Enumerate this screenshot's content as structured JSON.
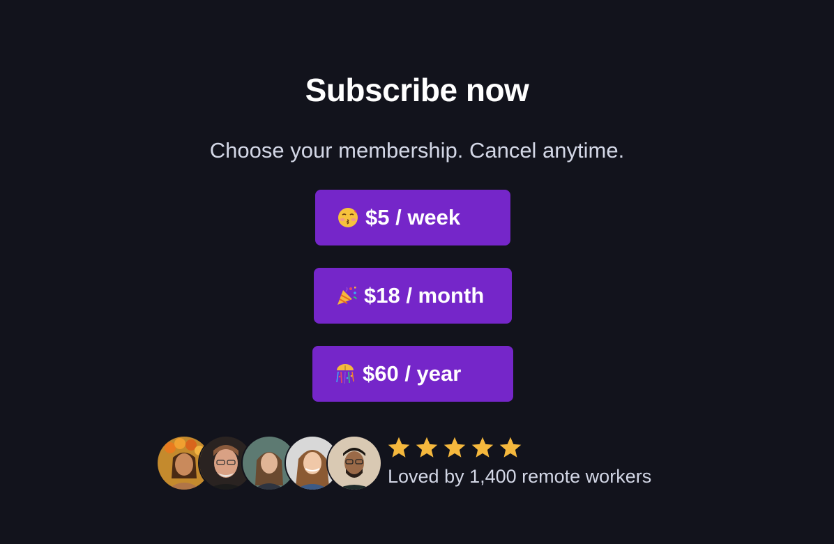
{
  "header": {
    "title": "Subscribe now",
    "subtitle": "Choose your membership. Cancel anytime."
  },
  "plans": [
    {
      "label": "$5 / week",
      "icon": "kissing-face-emoji-icon"
    },
    {
      "label": "$18 / month",
      "icon": "party-popper-emoji-icon"
    },
    {
      "label": "$60 / year",
      "icon": "confetti-ball-emoji-icon"
    }
  ],
  "social_proof": {
    "avatars": [
      "woman-flower-crown-avatar",
      "older-man-glasses-avatar",
      "woman-long-hair-avatar",
      "woman-smiling-avatar",
      "man-glasses-beard-avatar"
    ],
    "rating": 5,
    "text": "Loved by 1,400 remote workers"
  },
  "colors": {
    "background": "#12131c",
    "button": "#7526c9",
    "star": "#f5b83d",
    "text_muted": "#d3d7e6"
  }
}
